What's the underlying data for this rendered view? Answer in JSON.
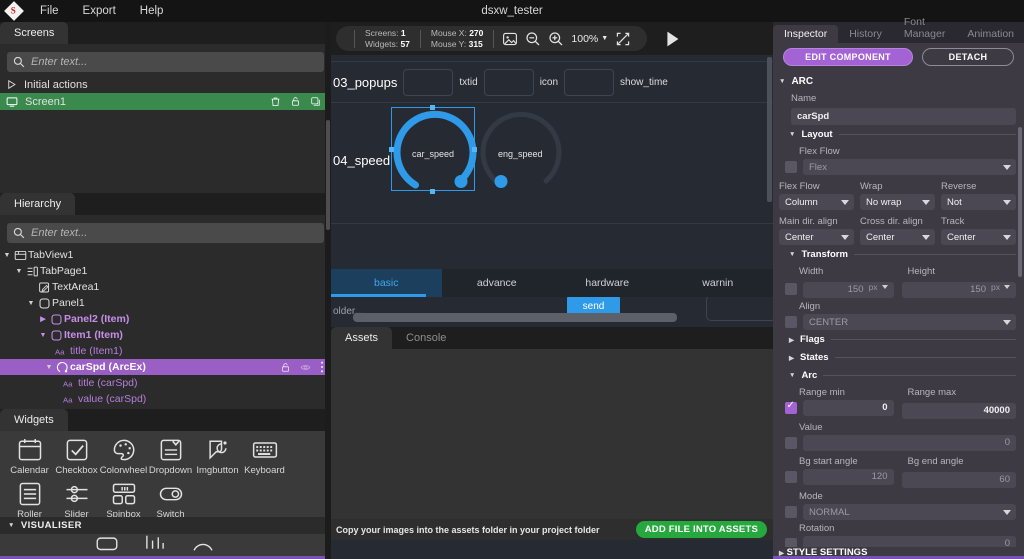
{
  "titlebar": {
    "logo_letter": "S",
    "window_title": "dsxw_tester",
    "menus": [
      "File",
      "Export",
      "Help"
    ]
  },
  "screens_panel": {
    "tab_label": "Screens",
    "search_placeholder": "Enter text...",
    "items": [
      {
        "label": "Initial actions",
        "icon": "play-triangle-icon",
        "selected": false
      },
      {
        "label": "Screen1",
        "icon": "monitor-icon",
        "selected": true,
        "actions": [
          "trash-icon",
          "lock-icon",
          "duplicate-icon"
        ]
      }
    ]
  },
  "hierarchy_panel": {
    "tab_label": "Hierarchy",
    "search_placeholder": "Enter text...",
    "nodes": [
      {
        "label": "TabView1",
        "indent": 0,
        "caret": "down",
        "icon": "tabview-icon",
        "style": "normal"
      },
      {
        "label": "TabPage1",
        "indent": 1,
        "caret": "down",
        "icon": "tabpage-icon",
        "style": "normal"
      },
      {
        "label": "TextArea1",
        "indent": 2,
        "caret": "none",
        "icon": "textarea-icon",
        "style": "normal"
      },
      {
        "label": "Panel1",
        "indent": 2,
        "caret": "down",
        "icon": "panel-icon",
        "style": "normal"
      },
      {
        "label": "Panel2 (Item)",
        "indent": 3,
        "caret": "right",
        "icon": "panel-icon",
        "style": "purple"
      },
      {
        "label": "Item1 (Item)",
        "indent": 3,
        "caret": "down",
        "icon": "panel-icon",
        "style": "purple"
      },
      {
        "label": "title (Item1)",
        "indent": 4,
        "caret": "none",
        "icon": "label-aa-icon",
        "style": "purple-plain"
      },
      {
        "label": "carSpd (ArcEx)",
        "indent": 4,
        "caret": "down",
        "icon": "arc-icon",
        "style": "selected",
        "actions": [
          "lock-icon",
          "eye-icon",
          "more-vert-icon"
        ]
      },
      {
        "label": "title (carSpd)",
        "indent": 5,
        "caret": "none",
        "icon": "label-aa-icon",
        "style": "purple-plain"
      },
      {
        "label": "value (carSpd)",
        "indent": 5,
        "caret": "none",
        "icon": "label-aa-icon",
        "style": "purple-plain"
      }
    ]
  },
  "widgets_panel": {
    "tab_label": "Widgets",
    "items": [
      {
        "label": "Calendar",
        "icon": "calendar-icon"
      },
      {
        "label": "Checkbox",
        "icon": "checkbox-icon"
      },
      {
        "label": "Colorwheel",
        "icon": "colorwheel-icon"
      },
      {
        "label": "Dropdown",
        "icon": "dropdown-icon"
      },
      {
        "label": "Imgbutton",
        "icon": "imgbutton-icon"
      },
      {
        "label": "Keyboard",
        "icon": "keyboard-icon"
      },
      {
        "label": "Roller",
        "icon": "roller-icon"
      },
      {
        "label": "Slider",
        "icon": "slider-icon"
      },
      {
        "label": "Spinbox",
        "icon": "spinbox-icon"
      },
      {
        "label": "Switch",
        "icon": "switch-icon"
      }
    ],
    "section_label": "VISUALISER"
  },
  "canvas_toolbar": {
    "screens_label": "Screens:",
    "screens_value": "1",
    "widgets_label": "Widgets:",
    "widgets_value": "57",
    "mouse_x_label": "Mouse X:",
    "mouse_x_value": "270",
    "mouse_y_label": "Mouse Y:",
    "mouse_y_value": "315",
    "zoom_value": "100%",
    "icons": [
      "image-icon",
      "zoom-out-icon",
      "zoom-in-icon",
      "fit-screen-icon",
      "play-icon"
    ]
  },
  "canvas": {
    "row_popups_label": "03_popups",
    "field_txtid_label": "txtid",
    "field_icon_label": "icon",
    "field_showtime_label": "show_time",
    "row_speed_label": "04_speed",
    "arc_selected_label": "car_speed",
    "arc_other_label": "eng_speed",
    "tabs": [
      {
        "label": "basic",
        "active": true
      },
      {
        "label": "advance",
        "active": false
      },
      {
        "label": "hardware",
        "active": false
      },
      {
        "label": "warnin",
        "active": false
      }
    ],
    "lower_text": "older...",
    "send_label": "send"
  },
  "assets_panel": {
    "tabs": [
      {
        "label": "Assets",
        "active": true
      },
      {
        "label": "Console",
        "active": false
      }
    ],
    "footer_text": "Copy your images into the assets folder in your project folder",
    "add_button": "ADD FILE INTO ASSETS"
  },
  "inspector": {
    "tabs": [
      {
        "label": "Inspector",
        "active": true
      },
      {
        "label": "History",
        "active": false
      },
      {
        "label": "Font Manager",
        "active": false
      },
      {
        "label": "Animation",
        "active": false
      }
    ],
    "edit_component_label": "EDIT COMPONENT",
    "detach_label": "DETACH",
    "section_arc": "ARC",
    "name_label": "Name",
    "name_value": "carSpd",
    "layout": {
      "title": "Layout",
      "flex_flow_label": "Flex Flow",
      "flex_flow_value": "Flex",
      "flex_flow2_label": "Flex Flow",
      "flex_flow2_value": "Column",
      "wrap_label": "Wrap",
      "wrap_value": "No wrap",
      "reverse_label": "Reverse",
      "reverse_value": "Not",
      "main_align_label": "Main dir. align",
      "main_align_value": "Center",
      "cross_align_label": "Cross dir. align",
      "cross_align_value": "Center",
      "track_label": "Track",
      "track_value": "Center"
    },
    "transform": {
      "title": "Transform",
      "width_label": "Width",
      "width_value": "150",
      "width_unit": "px",
      "height_label": "Height",
      "height_value": "150",
      "height_unit": "px",
      "align_label": "Align",
      "align_value": "CENTER"
    },
    "flags_title": "Flags",
    "states_title": "States",
    "arc": {
      "title": "Arc",
      "range_min_label": "Range min",
      "range_min_value": "0",
      "range_max_label": "Range max",
      "range_max_value": "40000",
      "value_label": "Value",
      "value_value": "0",
      "bg_start_label": "Bg start angle",
      "bg_start_value": "120",
      "bg_end_label": "Bg end angle",
      "bg_end_value": "60",
      "mode_label": "Mode",
      "mode_value": "NORMAL",
      "rotation_label": "Rotation",
      "rotation_value": "0"
    },
    "style_settings_title": "STYLE SETTINGS"
  },
  "colors": {
    "accent_purple": "#a463d4",
    "accent_blue": "#2f9ae8",
    "green_select": "#3a8a4e",
    "green_button": "#27a83f"
  }
}
